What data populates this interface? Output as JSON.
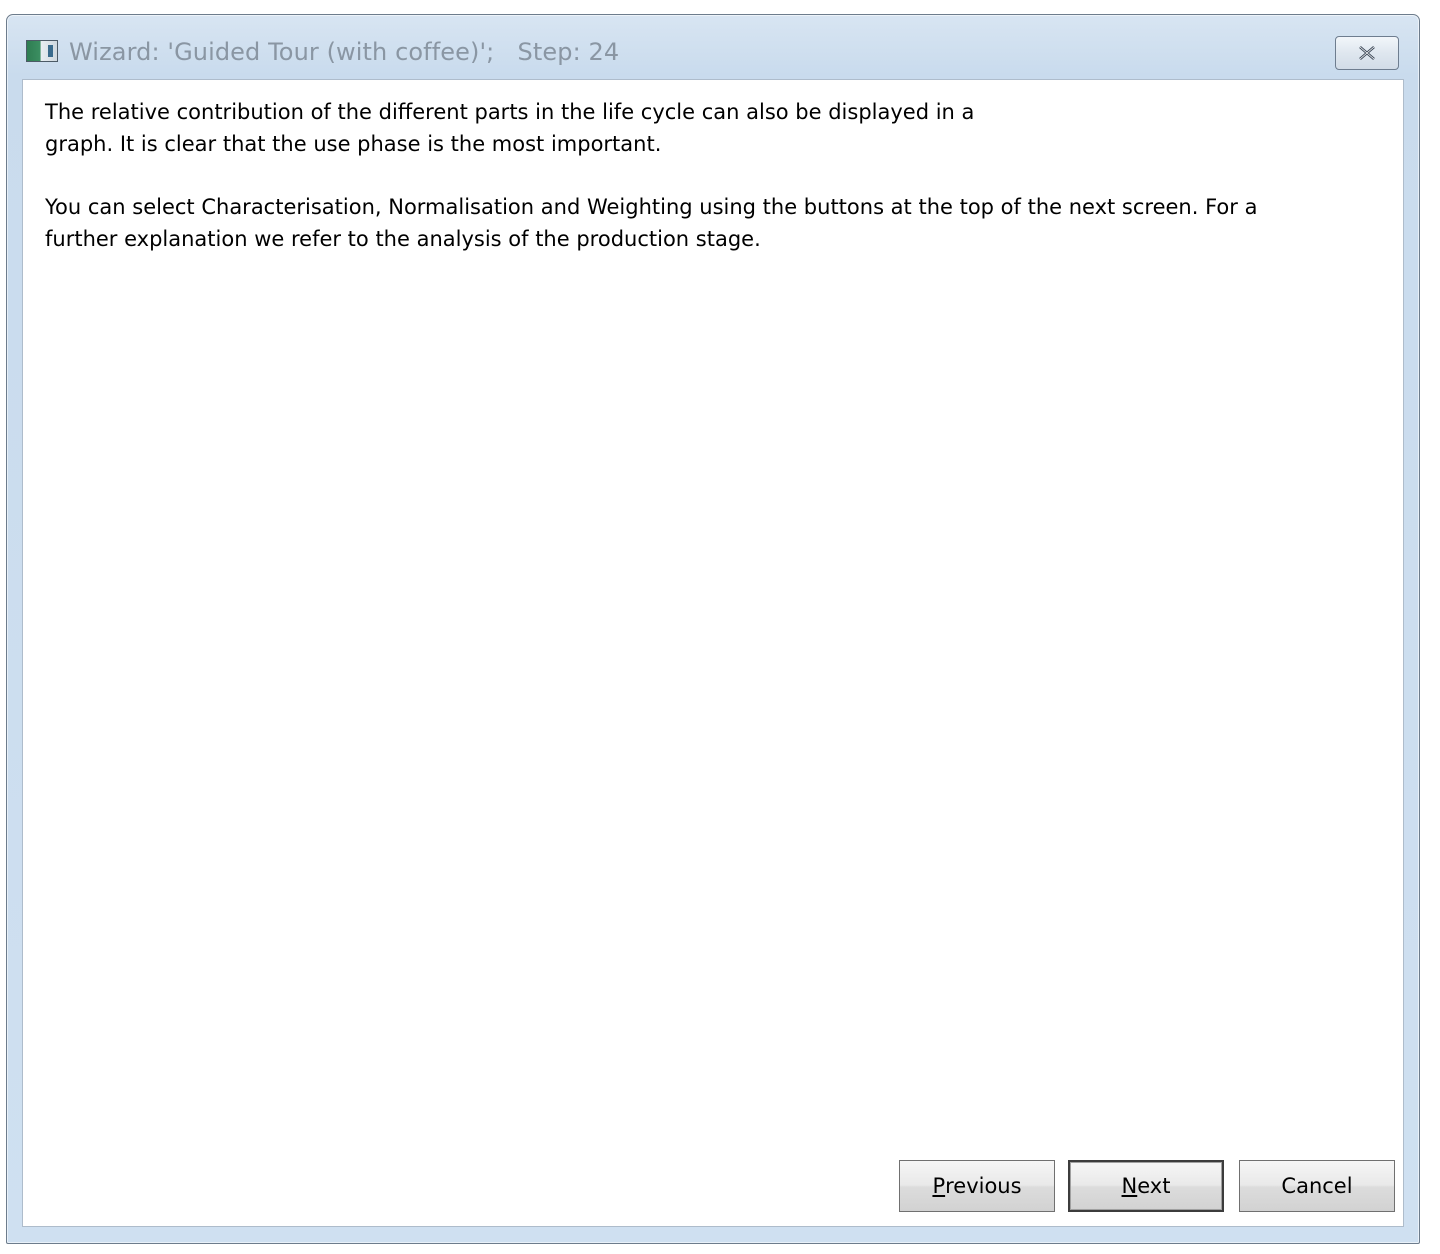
{
  "window": {
    "title": "Wizard: 'Guided Tour (with coffee)';   Step: 24",
    "icon": "app-window-icon",
    "close_icon": "close-icon"
  },
  "content": {
    "paragraph_1": "The relative contribution of the different parts in the life cycle can also be displayed in a\ngraph. It is clear that the use phase is the most important.",
    "paragraph_2": "You can select Characterisation, Normalisation and Weighting using the buttons at the top of the next screen. For a\nfurther explanation we refer to the analysis of the production stage."
  },
  "buttons": {
    "previous": {
      "accel": "P",
      "rest": "revious"
    },
    "next": {
      "accel": "N",
      "rest": "ext"
    },
    "cancel": "Cancel"
  }
}
